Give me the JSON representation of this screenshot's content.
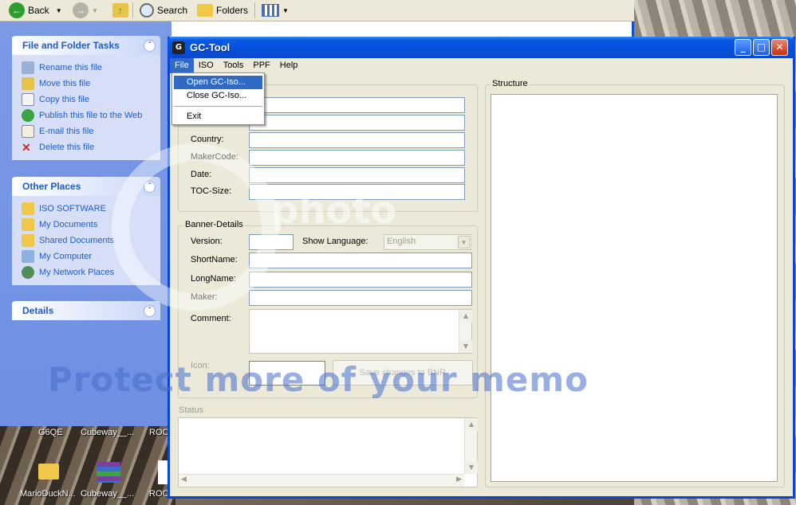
{
  "explorer": {
    "toolbar": {
      "back": "Back",
      "search": "Search",
      "folders": "Folders"
    },
    "file_and_folder_tasks": {
      "title": "File and Folder Tasks",
      "items": [
        "Rename this file",
        "Move this file",
        "Copy this file",
        "Publish this file to the Web",
        "E-mail this file",
        "Delete this file"
      ]
    },
    "other_places": {
      "title": "Other Places",
      "items": [
        "ISO SOFTWARE",
        "My Documents",
        "Shared Documents",
        "My Computer",
        "My Network Places"
      ]
    },
    "details": {
      "title": "Details"
    }
  },
  "desktop": {
    "icons_top": [
      "G6QE",
      "Cubeway__...",
      "ROC"
    ],
    "icons_bottom": [
      "MarioDuckN...",
      "Cubeway__...",
      "ROC"
    ]
  },
  "gctool": {
    "title": "GC-Tool",
    "menu": [
      "File",
      "ISO",
      "Tools",
      "PPF",
      "Help"
    ],
    "file_menu": [
      "Open GC-Iso...",
      "Close GC-Iso...",
      "Exit"
    ],
    "info_labels": [
      "Country:",
      "MakerCode:",
      "Date:",
      "TOC-Size:"
    ],
    "banner": {
      "legend": "Banner-Details",
      "version": "Version:",
      "show_language": "Show Language:",
      "language_value": "English",
      "shortname": "ShortName:",
      "longname": "LongName:",
      "maker": "Maker:",
      "comment": "Comment:",
      "icon": "Icon:",
      "save_button": "Save changes to BNR"
    },
    "status_legend": "Status",
    "structure_legend": "Structure"
  },
  "watermark": {
    "text": "Protect more of your memo",
    "brand": "photo"
  }
}
